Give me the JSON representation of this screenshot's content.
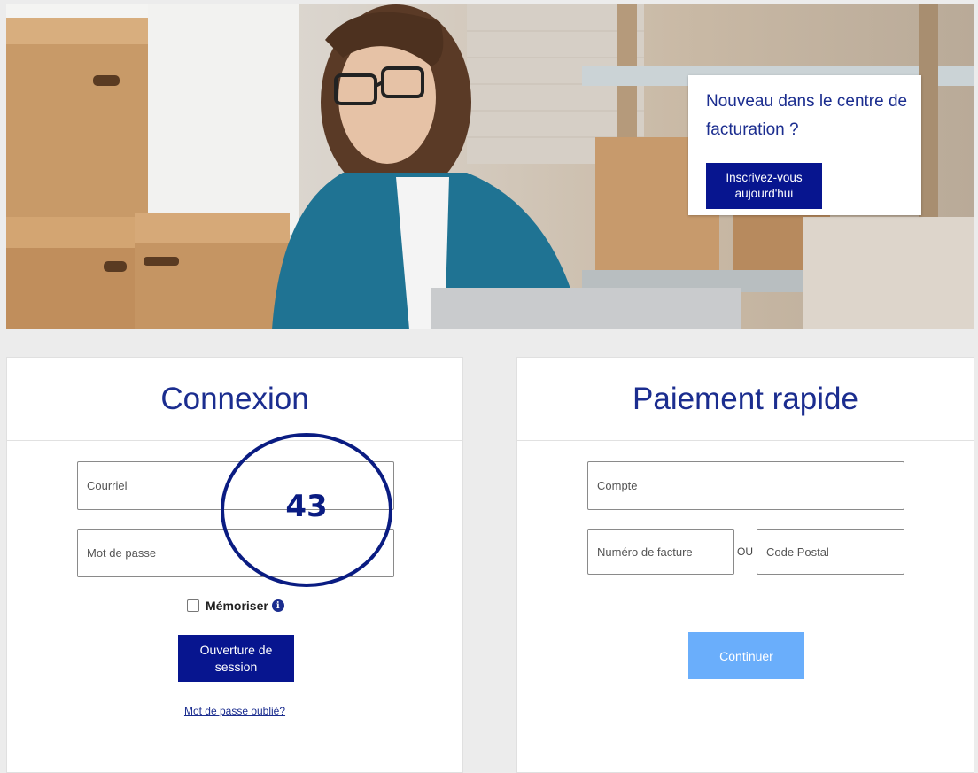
{
  "hero": {
    "image": "woman-at-laptop-with-boxes",
    "promo": {
      "text": "Nouveau dans le centre de facturation ?",
      "button_label": "Inscrivez-vous aujourd'hui"
    }
  },
  "login": {
    "title": "Connexion",
    "email_placeholder": "Courriel",
    "password_placeholder": "Mot de passe",
    "remember_label": "Mémoriser",
    "info_glyph": "i",
    "submit_label": "Ouverture de session",
    "forgot_label": "Mot de passe oublié?"
  },
  "quick_pay": {
    "title": "Paiement rapide",
    "account_placeholder": "Compte",
    "invoice_placeholder": "Numéro de facture",
    "or_label": "OU",
    "postal_placeholder": "Code Postal",
    "continue_label": "Continuer"
  },
  "annotation": {
    "number": "43"
  },
  "colors": {
    "brand_navy": "#07158f",
    "title_blue": "#1b2d8f",
    "continue_light_blue": "#6aaefb",
    "page_background": "#ececec"
  }
}
